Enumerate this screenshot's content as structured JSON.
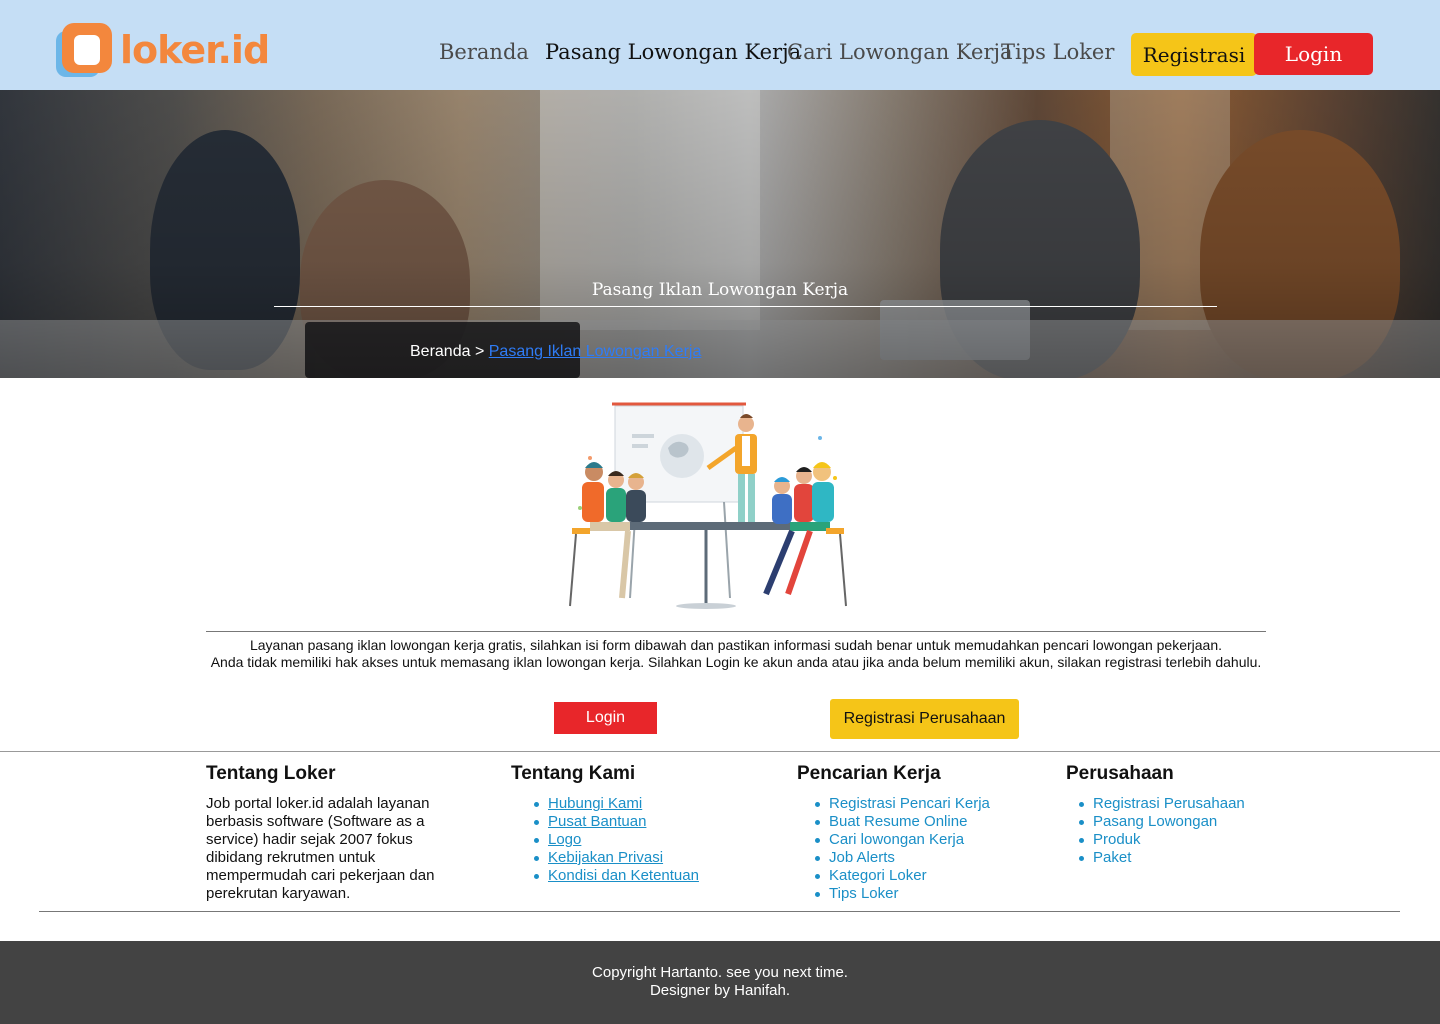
{
  "header": {
    "logo_text": "loker.id",
    "nav": [
      {
        "label": "Beranda",
        "active": false
      },
      {
        "label": "Pasang Lowongan Kerja",
        "active": true
      },
      {
        "label": "Cari Lowongan Kerja",
        "active": false
      },
      {
        "label": "Tips Loker",
        "active": false
      }
    ],
    "register_label": "Registrasi",
    "login_label": "Login"
  },
  "hero": {
    "title": "Pasang Iklan Lowongan Kerja",
    "breadcrumb_home": "Beranda",
    "breadcrumb_separator": ">",
    "breadcrumb_current": "Pasang Iklan Lowongan Kerja"
  },
  "notice": {
    "line1": "Layanan pasang iklan lowongan kerja gratis, silahkan isi form dibawah dan pastikan informasi sudah benar untuk memudahkan pencari lowongan pekerjaan.",
    "line2": "Anda tidak memiliki hak akses untuk memasang iklan lowongan kerja. Silahkan Login ke akun anda atau jika anda belum memiliki akun, silakan registrasi terlebih dahulu.",
    "login_label": "Login",
    "register_label": "Registrasi Perusahaan"
  },
  "footer": {
    "about_loker": {
      "heading": "Tentang Loker",
      "text": "Job portal loker.id adalah layanan  berbasis software (Software as a service) hadir sejak 2007 fokus dibidang rekrutmen untuk mempermudah cari pekerjaan dan perekrutan karyawan."
    },
    "about_us": {
      "heading": "Tentang Kami",
      "links": [
        "Hubungi Kami",
        "Pusat Bantuan",
        "Logo",
        "Kebijakan Privasi",
        "Kondisi dan Ketentuan"
      ]
    },
    "job_search": {
      "heading": "Pencarian Kerja",
      "links": [
        "Registrasi Pencari Kerja",
        "Buat Resume Online",
        "Cari lowongan Kerja",
        "Job Alerts",
        "Kategori Loker",
        "Tips Loker"
      ]
    },
    "company": {
      "heading": "Perusahaan",
      "links": [
        "Registrasi Perusahaan",
        "Pasang Lowongan",
        "Produk",
        "Paket"
      ]
    }
  },
  "copyright": {
    "line1": "Copyright Hartanto. see you next time.",
    "line2": "Designer by Hanifah."
  },
  "colors": {
    "header_bg": "#c5def5",
    "brand_orange": "#f3873d",
    "brand_blue": "#6cb6e8",
    "login_red": "#e8262a",
    "register_yellow": "#f5c518",
    "link_blue": "#1a8fc7",
    "breadcrumb_link": "#2f7cf6",
    "footer_bar": "#434343"
  },
  "icons": {
    "logo": "loker-logo-icon",
    "illustration": "meeting-illustration",
    "list_bullet": "bullet-icon"
  }
}
